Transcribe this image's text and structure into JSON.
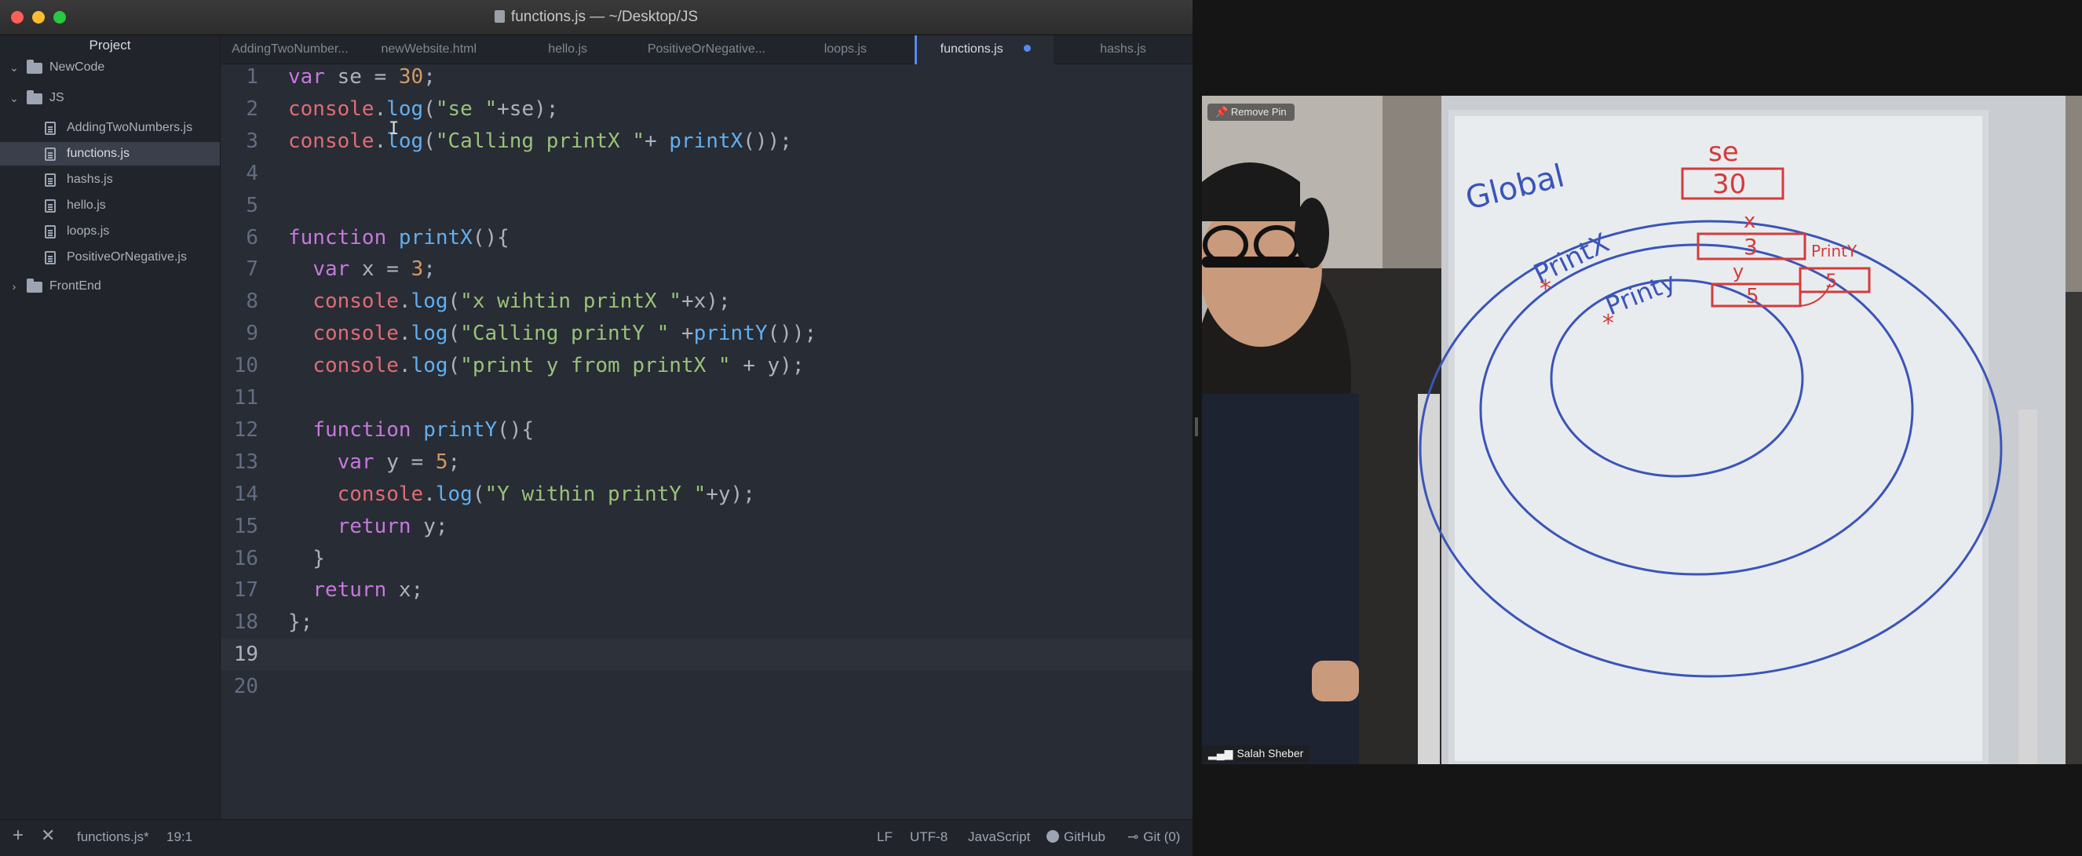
{
  "window": {
    "title": "functions.js — ~/Desktop/JS"
  },
  "sidebar": {
    "header": "Project",
    "tree": [
      {
        "type": "folder",
        "label": "NewCode",
        "expanded": true,
        "icon": "folder-icon"
      },
      {
        "type": "folder",
        "label": "JS",
        "expanded": true,
        "icon": "folder-icon"
      },
      {
        "type": "file",
        "label": "AddingTwoNumbers.js",
        "icon": "file-icon"
      },
      {
        "type": "file",
        "label": "functions.js",
        "selected": true,
        "icon": "file-icon"
      },
      {
        "type": "file",
        "label": "hashs.js",
        "icon": "file-icon"
      },
      {
        "type": "file",
        "label": "hello.js",
        "icon": "file-icon"
      },
      {
        "type": "file",
        "label": "loops.js",
        "icon": "file-icon"
      },
      {
        "type": "file",
        "label": "PositiveOrNegative.js",
        "icon": "file-icon"
      },
      {
        "type": "folder",
        "label": "FrontEnd",
        "expanded": false,
        "icon": "folder-icon"
      }
    ]
  },
  "tabs": [
    {
      "label": "AddingTwoNumber..."
    },
    {
      "label": "newWebsite.html"
    },
    {
      "label": "hello.js"
    },
    {
      "label": "PositiveOrNegative..."
    },
    {
      "label": "loops.js"
    },
    {
      "label": "functions.js",
      "active": true,
      "modified": true
    },
    {
      "label": "hashs.js"
    }
  ],
  "code": {
    "current_line": 19,
    "lines": [
      "var se = 30;",
      "console.log(\"se \"+se);",
      "console.log(\"Calling printX \"+ printX());",
      "",
      "",
      "function printX(){",
      "  var x = 3;",
      "  console.log(\"x wihtin printX \"+x);",
      "  console.log(\"Calling printY \" +printY());",
      "  console.log(\"print y from printX \" + y);",
      "",
      "  function printY(){",
      "    var y = 5;",
      "    console.log(\"Y within printY \"+y);",
      "    return y;",
      "  }",
      "  return x;",
      "};",
      "",
      ""
    ]
  },
  "statusbar": {
    "add_icon": "plus-icon",
    "close_icon": "close-icon",
    "file": "functions.js*",
    "cursor_pos": "19:1",
    "line_ending": "LF",
    "encoding": "UTF-8",
    "grammar": "JavaScript",
    "github": "GitHub",
    "git": "Git (0)"
  },
  "video": {
    "pin_label": "Remove Pin",
    "participant_name": "Salah Sheber",
    "whiteboard_text": {
      "global": "Global",
      "se": "se",
      "se_value": "30",
      "printx": "PrintX",
      "x": "x",
      "x_value": "3",
      "printy": "Printy",
      "y": "y",
      "y_value": "5",
      "printy_small": "PrintY",
      "printy_value": "5"
    }
  }
}
